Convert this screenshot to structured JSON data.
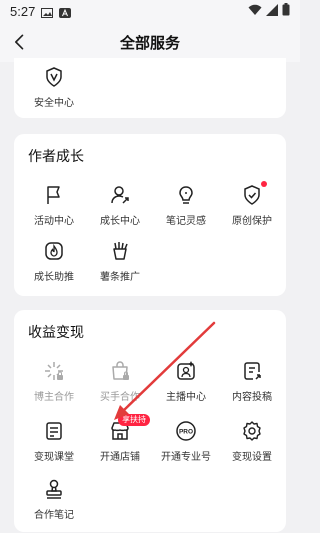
{
  "status_bar": {
    "time": "5:27"
  },
  "header": {
    "title": "全部服务"
  },
  "cards": [
    {
      "items": [
        {
          "label": "安全中心",
          "icon": "shield-v-icon"
        }
      ]
    },
    {
      "title": "作者成长",
      "items": [
        {
          "label": "活动中心",
          "icon": "flag-icon"
        },
        {
          "label": "成长中心",
          "icon": "user-growth-icon"
        },
        {
          "label": "笔记灵感",
          "icon": "bulb-icon"
        },
        {
          "label": "原创保护",
          "icon": "shield-check-icon"
        },
        {
          "label": "成长助推",
          "icon": "flame-icon"
        },
        {
          "label": "薯条推广",
          "icon": "fries-icon"
        }
      ]
    },
    {
      "title": "收益变现",
      "items": [
        {
          "label": "博主合作",
          "icon": "sparkle-lock-icon"
        },
        {
          "label": "买手合作",
          "icon": "bag-lock-icon"
        },
        {
          "label": "主播中心",
          "icon": "streamer-icon"
        },
        {
          "label": "内容投稿",
          "icon": "submit-doc-icon"
        },
        {
          "label": "变现课堂",
          "icon": "book-icon"
        },
        {
          "label": "开通店铺",
          "icon": "store-icon"
        },
        {
          "label": "开通专业号",
          "icon": "pro-icon"
        },
        {
          "label": "变现设置",
          "icon": "gear-icon"
        },
        {
          "label": "合作笔记",
          "icon": "stamp-icon"
        }
      ],
      "badge": "享扶持"
    }
  ],
  "colors": {
    "accent": "#ff2442",
    "arrow": "#e23b3b"
  }
}
